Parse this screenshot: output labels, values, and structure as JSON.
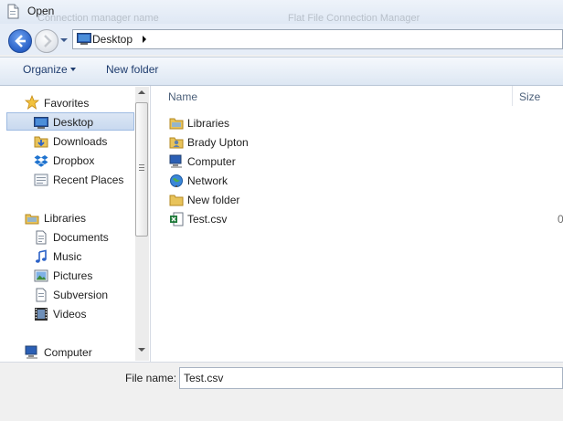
{
  "window": {
    "title": "Open",
    "ghost_text_left": "Connection manager name",
    "ghost_text_right": "Flat File Connection Manager"
  },
  "address_bar": {
    "location": "Desktop",
    "icon": "desktop-icon"
  },
  "toolbar": {
    "organize_label": "Organize",
    "new_folder_label": "New folder"
  },
  "nav": {
    "favorites_header": "Favorites",
    "favorites": [
      {
        "label": "Desktop",
        "icon": "desktop-icon",
        "selected": true
      },
      {
        "label": "Downloads",
        "icon": "downloads-icon"
      },
      {
        "label": "Dropbox",
        "icon": "dropbox-icon"
      },
      {
        "label": "Recent Places",
        "icon": "recent-places-icon"
      }
    ],
    "libraries_header": "Libraries",
    "libraries": [
      {
        "label": "Documents",
        "icon": "documents-icon"
      },
      {
        "label": "Music",
        "icon": "music-icon"
      },
      {
        "label": "Pictures",
        "icon": "pictures-icon"
      },
      {
        "label": "Subversion",
        "icon": "subversion-icon"
      },
      {
        "label": "Videos",
        "icon": "videos-icon"
      }
    ],
    "computer_header": "Computer"
  },
  "file_list": {
    "columns": [
      "Name",
      "Size"
    ],
    "items": [
      {
        "name": "Libraries",
        "icon": "libraries-icon",
        "size": ""
      },
      {
        "name": "Brady Upton",
        "icon": "user-folder-icon",
        "size": ""
      },
      {
        "name": "Computer",
        "icon": "computer-icon",
        "size": ""
      },
      {
        "name": "Network",
        "icon": "network-icon",
        "size": ""
      },
      {
        "name": "New folder",
        "icon": "folder-icon",
        "size": ""
      },
      {
        "name": "Test.csv",
        "icon": "excel-csv-icon",
        "size": "0"
      }
    ]
  },
  "bottom": {
    "filename_label": "File name:",
    "filename_value": "Test.csv"
  },
  "colors": {
    "selection": "#c8d9ef",
    "toolbar_text": "#1e3c6e",
    "folder_yellow": "#e8c35a"
  }
}
